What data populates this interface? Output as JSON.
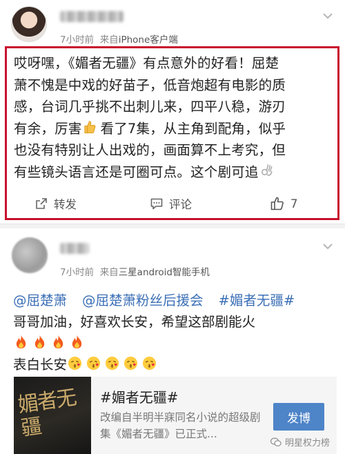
{
  "post1": {
    "author_name": "",
    "time": "7小时前",
    "source_prefix": "来自",
    "source": "iPhone客户端",
    "lines": [
      "哎呀嘿，《媚者无疆》有点意外的好看！屈楚",
      "萧不愧是中戏的好苗子，低音炮超有电影的质",
      "感，台词几乎挑不出刺儿来，四平八稳，游刃",
      "有余，厉害",
      "看了7集，从主角到配角，似乎",
      "也没有特别让人出戏的，画面算不上考究，但",
      "有些镜头语言还是可圈可点。这个剧可追"
    ],
    "actions": {
      "share_label": "转发",
      "comment_label": "评论",
      "like_count": "7"
    }
  },
  "post2": {
    "author_name": "",
    "time": "7小时前",
    "source_prefix": "来自",
    "source": "三星android智能手机",
    "mentions": [
      "@屈楚萧",
      "@屈楚萧粉丝后援会",
      "#媚者无疆#"
    ],
    "line1": "哥哥加油，好喜欢长安，希望这部剧能火",
    "line3": "表白长安",
    "share_card": {
      "title": "#媚者无疆#",
      "desc": "改编自半明半寐同名小说的超级剧集《媚者无疆》已正式...",
      "button_label": "发博",
      "thumb_text": "媚者无疆"
    }
  },
  "watermark": "明星权力榜",
  "colors": {
    "highlight_frame": "#c8102e",
    "link_blue": "#3b6fb6",
    "button_blue": "#4e84c8"
  },
  "icons": [
    "chevron-down-icon",
    "share-icon",
    "comment-icon",
    "like-icon",
    "thumbs-up-emoji",
    "ok-hand-emoji",
    "fire-emoji",
    "kiss-emoji",
    "wechat-icon"
  ]
}
